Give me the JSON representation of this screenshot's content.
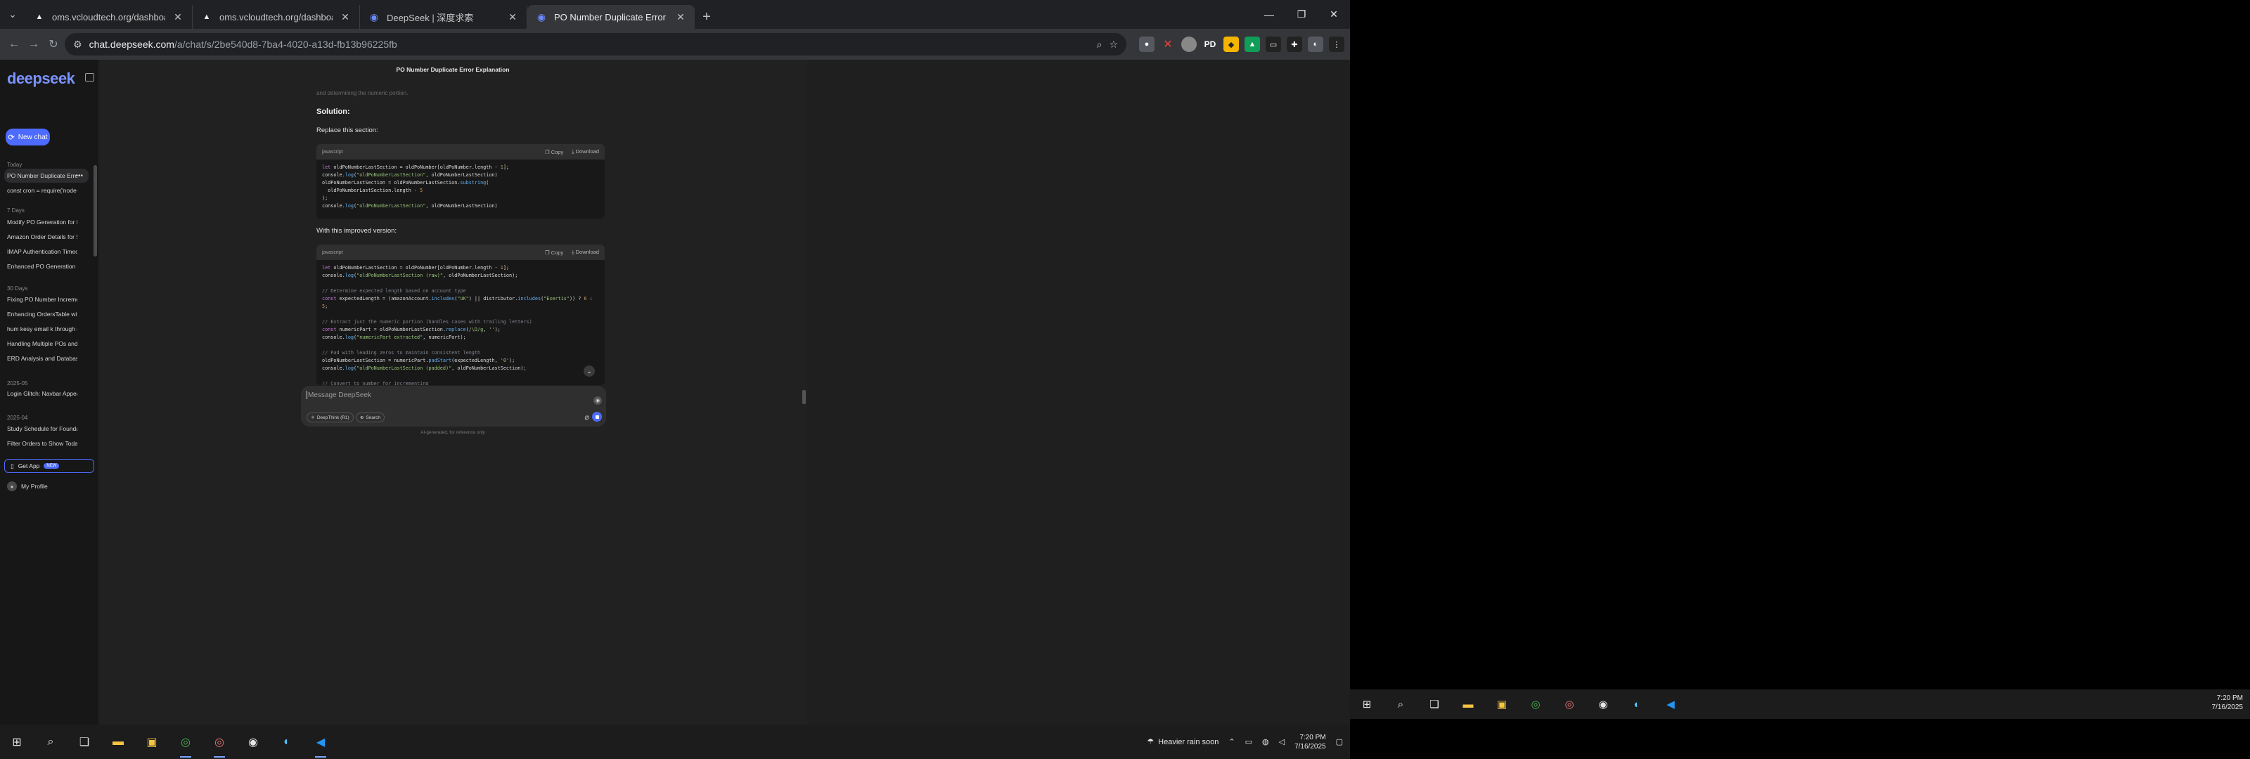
{
  "tabs": [
    {
      "title": "oms.vcloudtech.org/dashboard",
      "icon": "tab-favicon"
    },
    {
      "title": "oms.vcloudtech.org/dashboard",
      "icon": "tab-favicon"
    },
    {
      "title": "DeepSeek | 深度求索",
      "icon": "deepseek-favicon"
    },
    {
      "title": "PO Number Duplicate Error Exp",
      "icon": "deepseek-favicon"
    }
  ],
  "address": {
    "host": "chat.deepseek.com",
    "path": "/a/chat/s/2be540d8-7ba4-4020-a13d-fb13b96225fb"
  },
  "extensions": {
    "pd": "PD"
  },
  "sidebar": {
    "logo": "deepseek",
    "new_chat": "New chat",
    "sections": [
      {
        "label": "Today",
        "items": [
          "PO Number Duplicate Error",
          "const cron = require('node-cron"
        ]
      },
      {
        "label": "7 Days",
        "items": [
          "Modify PO Generation for Multi",
          "Amazon Order Details for Surge",
          "IMAP Authentication Timeout Er",
          "Enhanced PO Generation for Mu"
        ]
      },
      {
        "label": "30 Days",
        "items": [
          "Fixing PO Number Increment Iss",
          "Enhancing OrdersTable with Pro",
          "hum kesy email k through code",
          "Handling Multiple POs and TXW",
          "ERD Analysis and Database Mod"
        ]
      },
      {
        "label": "2025-05",
        "items": [
          "Login Glitch: Navbar Appears Al"
        ]
      },
      {
        "label": "2025-04",
        "items": [
          "Study Schedule for Foundation",
          "Filter Orders to Show Today and"
        ]
      }
    ],
    "get_app": "Get App",
    "get_app_badge": "NEW",
    "profile": "My Profile"
  },
  "main": {
    "chat_title": "PO Number Duplicate Error Explanation",
    "faded_text": "and determining the numeric portion.",
    "solution_heading": "Solution:",
    "replace_text": "Replace this section:",
    "improved_text": "With this improved version:",
    "code_lang": "javascript",
    "copy_label": "Copy",
    "download_label": "Download"
  },
  "composer": {
    "placeholder": "Message DeepSeek",
    "deepthink": "DeepThink (R1)",
    "search": "Search",
    "disclaimer": "AI-generated, for reference only"
  },
  "taskbar": {
    "weather": "Heavier rain soon",
    "time": "7:20 PM",
    "date": "7/16/2025"
  }
}
